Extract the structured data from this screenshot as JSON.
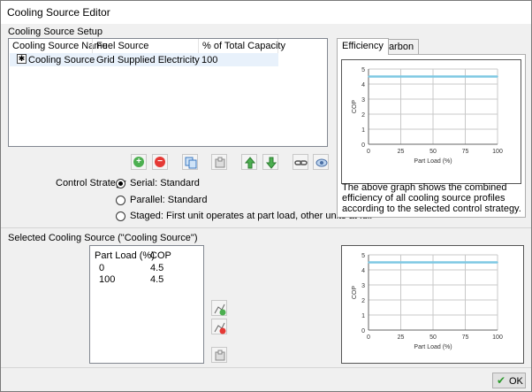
{
  "window": {
    "title": "Cooling Source Editor"
  },
  "setup": {
    "group_label": "Cooling Source Setup",
    "columns": [
      "Cooling Source Name",
      "Fuel Source",
      "% of Total Capacity"
    ],
    "rows": [
      {
        "name": "Cooling Source",
        "fuel": "Grid Supplied Electricity",
        "capacity": "100"
      }
    ],
    "toolbar_icons": [
      "add-icon",
      "remove-icon",
      "copy-icon",
      "library-icon",
      "move-up-icon",
      "move-down-icon",
      "link-icon",
      "eye-icon"
    ],
    "control_strategy_label": "Control Strategy",
    "strategies": [
      {
        "label": "Serial: Standard",
        "selected": true
      },
      {
        "label": "Parallel: Standard",
        "selected": false
      },
      {
        "label": "Staged: First unit operates at part load, other units at full",
        "selected": false
      }
    ]
  },
  "tabs": [
    {
      "label": "Efficiency",
      "active": true
    },
    {
      "label": "Carbon",
      "active": false
    }
  ],
  "efficiency_description": "The above graph shows the combined efficiency of all cooling source profiles according to the selected control strategy.",
  "selected": {
    "group_label": "Selected Cooling Source (\"Cooling Source\")",
    "columns": [
      "Part Load (%)",
      "COP"
    ],
    "rows": [
      {
        "load": "0",
        "cop": "4.5"
      },
      {
        "load": "100",
        "cop": "4.5"
      }
    ],
    "side_icons": [
      "add-point-icon",
      "remove-point-icon",
      "library-icon"
    ]
  },
  "ok_label": "OK",
  "colors": {
    "series": "#7ec8e3",
    "grid": "#c8c8c8",
    "selection": "#e8f1fb"
  },
  "chart_data": [
    {
      "type": "line",
      "xlabel": "Part Load (%)",
      "ylabel": "COP",
      "xlim": [
        0,
        100
      ],
      "ylim": [
        0,
        5
      ],
      "xticks": [
        "0",
        "25",
        "50",
        "75",
        "100"
      ],
      "yticks": [
        "0",
        "1",
        "2",
        "3",
        "4",
        "5"
      ],
      "grid": true,
      "x": [
        0,
        100
      ],
      "series": [
        {
          "values": [
            4.5,
            4.5
          ]
        }
      ]
    },
    {
      "type": "line",
      "xlabel": "Part Load (%)",
      "ylabel": "COP",
      "xlim": [
        0,
        100
      ],
      "ylim": [
        0,
        5
      ],
      "xticks": [
        "0",
        "25",
        "50",
        "75",
        "100"
      ],
      "yticks": [
        "0",
        "1",
        "2",
        "3",
        "4",
        "5"
      ],
      "grid": true,
      "x": [
        0,
        100
      ],
      "series": [
        {
          "values": [
            4.5,
            4.5
          ]
        }
      ]
    }
  ]
}
